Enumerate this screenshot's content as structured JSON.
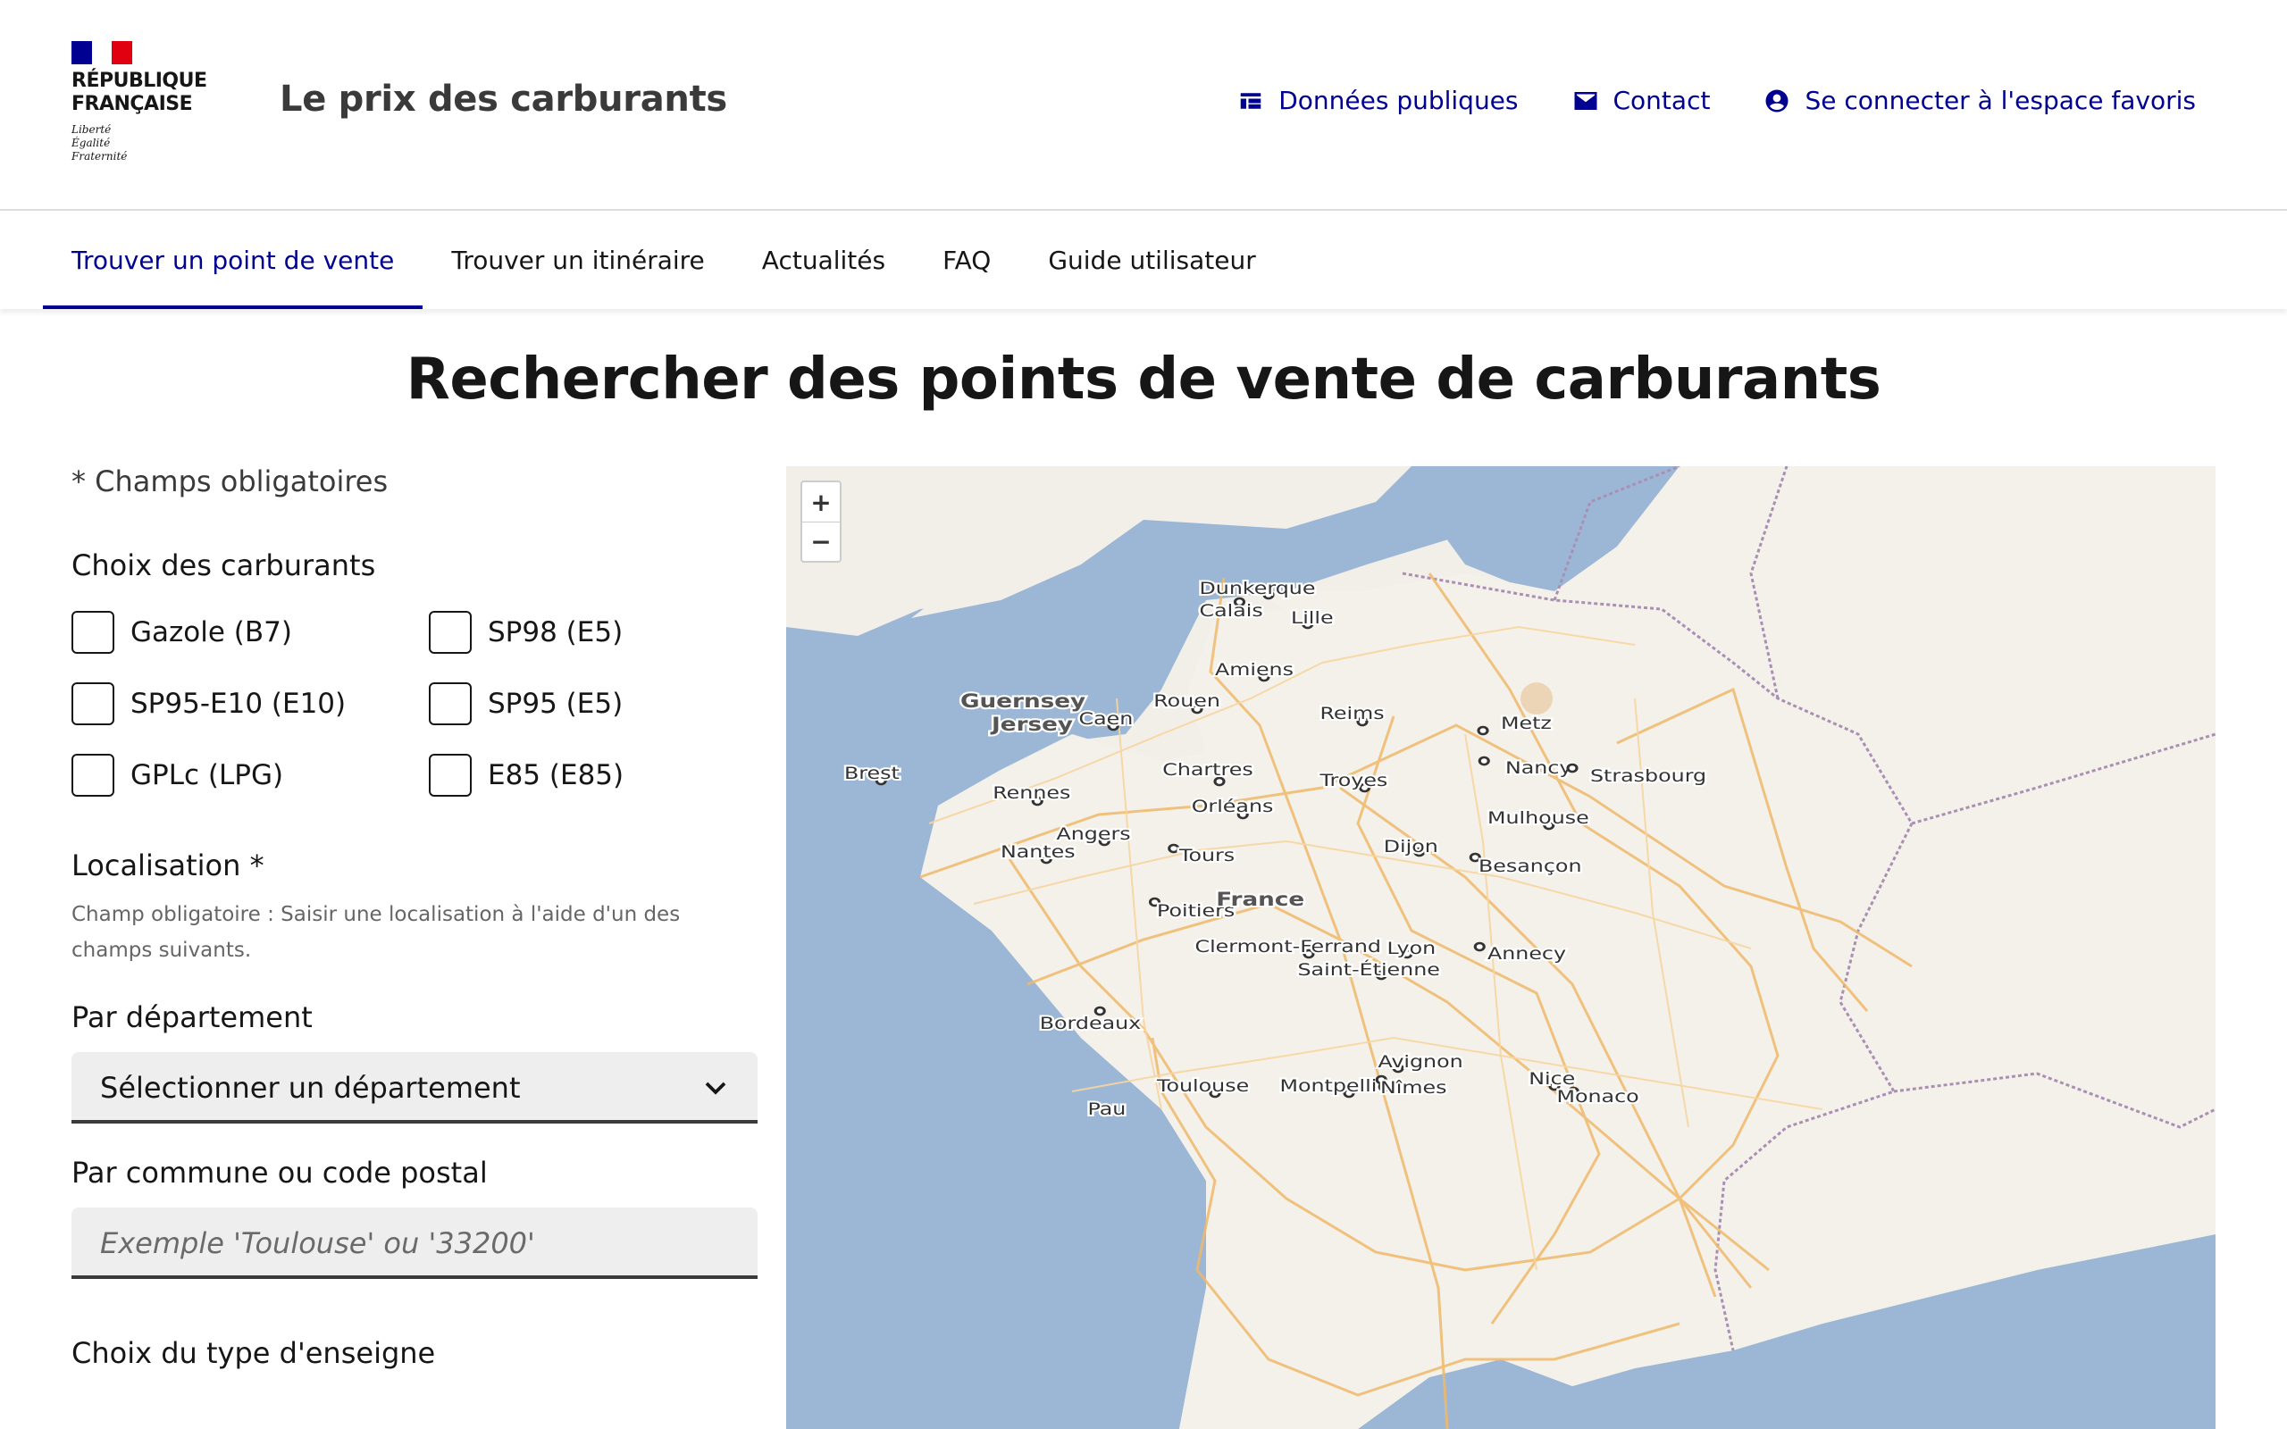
{
  "header": {
    "logo_lines": [
      "RÉPUBLIQUE",
      "FRANÇAISE"
    ],
    "motto": [
      "Liberté",
      "Égalité",
      "Fraternité"
    ],
    "site_title": "Le prix des carburants",
    "links": [
      {
        "label": "Données publiques",
        "icon": "data-icon"
      },
      {
        "label": "Contact",
        "icon": "mail-icon"
      },
      {
        "label": "Se connecter à l'espace favoris",
        "icon": "account-icon"
      }
    ]
  },
  "nav": {
    "items": [
      {
        "label": "Trouver un point de vente",
        "active": true
      },
      {
        "label": "Trouver un itinéraire",
        "active": false
      },
      {
        "label": "Actualités",
        "active": false
      },
      {
        "label": "FAQ",
        "active": false
      },
      {
        "label": "Guide utilisateur",
        "active": false
      }
    ]
  },
  "main": {
    "title": "Rechercher des points de vente de carburants",
    "required_note": "* Champs obligatoires",
    "fuels_label": "Choix des carburants",
    "fuels": [
      {
        "label": "Gazole (B7)",
        "checked": false
      },
      {
        "label": "SP98 (E5)",
        "checked": false
      },
      {
        "label": "SP95-E10 (E10)",
        "checked": false
      },
      {
        "label": "SP95 (E5)",
        "checked": false
      },
      {
        "label": "GPLc (LPG)",
        "checked": false
      },
      {
        "label": "E85 (E85)",
        "checked": false
      }
    ],
    "location_label": "Localisation *",
    "location_help": "Champ obligatoire : Saisir une localisation à l'aide d'un des champs suivants.",
    "department_label": "Par département",
    "department_value": "Sélectionner un département",
    "commune_label": "Par commune ou code postal",
    "commune_placeholder": "Exemple 'Toulouse' ou '33200'",
    "brand_label": "Choix du type d'enseigne"
  },
  "map": {
    "zoom_in": "+",
    "zoom_out": "−",
    "country_labels": [
      "Guernsey",
      "Jersey",
      "France"
    ],
    "cities": [
      "Dunkerque",
      "Calais",
      "Lille",
      "Amiens",
      "Rouen",
      "Caen",
      "Reims",
      "Metz",
      "Brest",
      "Rennes",
      "Chartres",
      "Troyes",
      "Nancy",
      "Strasbourg",
      "Orléans",
      "Mulhouse",
      "Angers",
      "Nantes",
      "Tours",
      "Dijon",
      "Besançon",
      "Poitiers",
      "Clermont-Ferrand",
      "Lyon",
      "Saint-Étienne",
      "Annecy",
      "Bordeaux",
      "Avignon",
      "Nice",
      "Toulouse",
      "Montpellier",
      "Nîmes",
      "Monaco",
      "Pau"
    ],
    "colors": {
      "sea": "#9cb7d6",
      "land": "#f2efe9",
      "roads": "#f0b96b",
      "border": "#a98fb3"
    }
  }
}
